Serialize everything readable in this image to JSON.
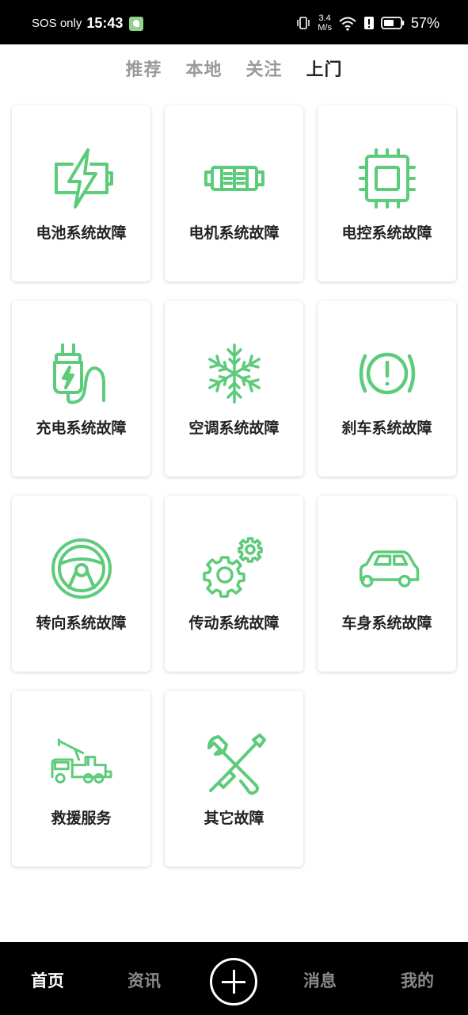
{
  "status_bar": {
    "sos": "SOS only",
    "time": "15:43",
    "speed_top": "3.4",
    "speed_bottom": "M/s",
    "battery": "57%"
  },
  "top_tabs": [
    {
      "label": "推荐",
      "active": false
    },
    {
      "label": "本地",
      "active": false
    },
    {
      "label": "关注",
      "active": false
    },
    {
      "label": "上门",
      "active": true
    }
  ],
  "services": [
    {
      "label": "电池系统故障",
      "icon": "battery-bolt-icon"
    },
    {
      "label": "电机系统故障",
      "icon": "motor-icon"
    },
    {
      "label": "电控系统故障",
      "icon": "chip-icon"
    },
    {
      "label": "充电系统故障",
      "icon": "charging-plug-icon"
    },
    {
      "label": "空调系统故障",
      "icon": "snowflake-icon"
    },
    {
      "label": "刹车系统故障",
      "icon": "brake-warning-icon"
    },
    {
      "label": "转向系统故障",
      "icon": "steering-wheel-icon"
    },
    {
      "label": "传动系统故障",
      "icon": "gears-icon"
    },
    {
      "label": "车身系统故障",
      "icon": "car-icon"
    },
    {
      "label": "救援服务",
      "icon": "tow-truck-icon"
    },
    {
      "label": "其它故障",
      "icon": "wrench-screwdriver-icon"
    }
  ],
  "accent_color": "#5ccb7a",
  "bottom_nav": {
    "home": "首页",
    "news": "资讯",
    "add_icon": "plus-circle-icon",
    "messages": "消息",
    "mine": "我的"
  }
}
